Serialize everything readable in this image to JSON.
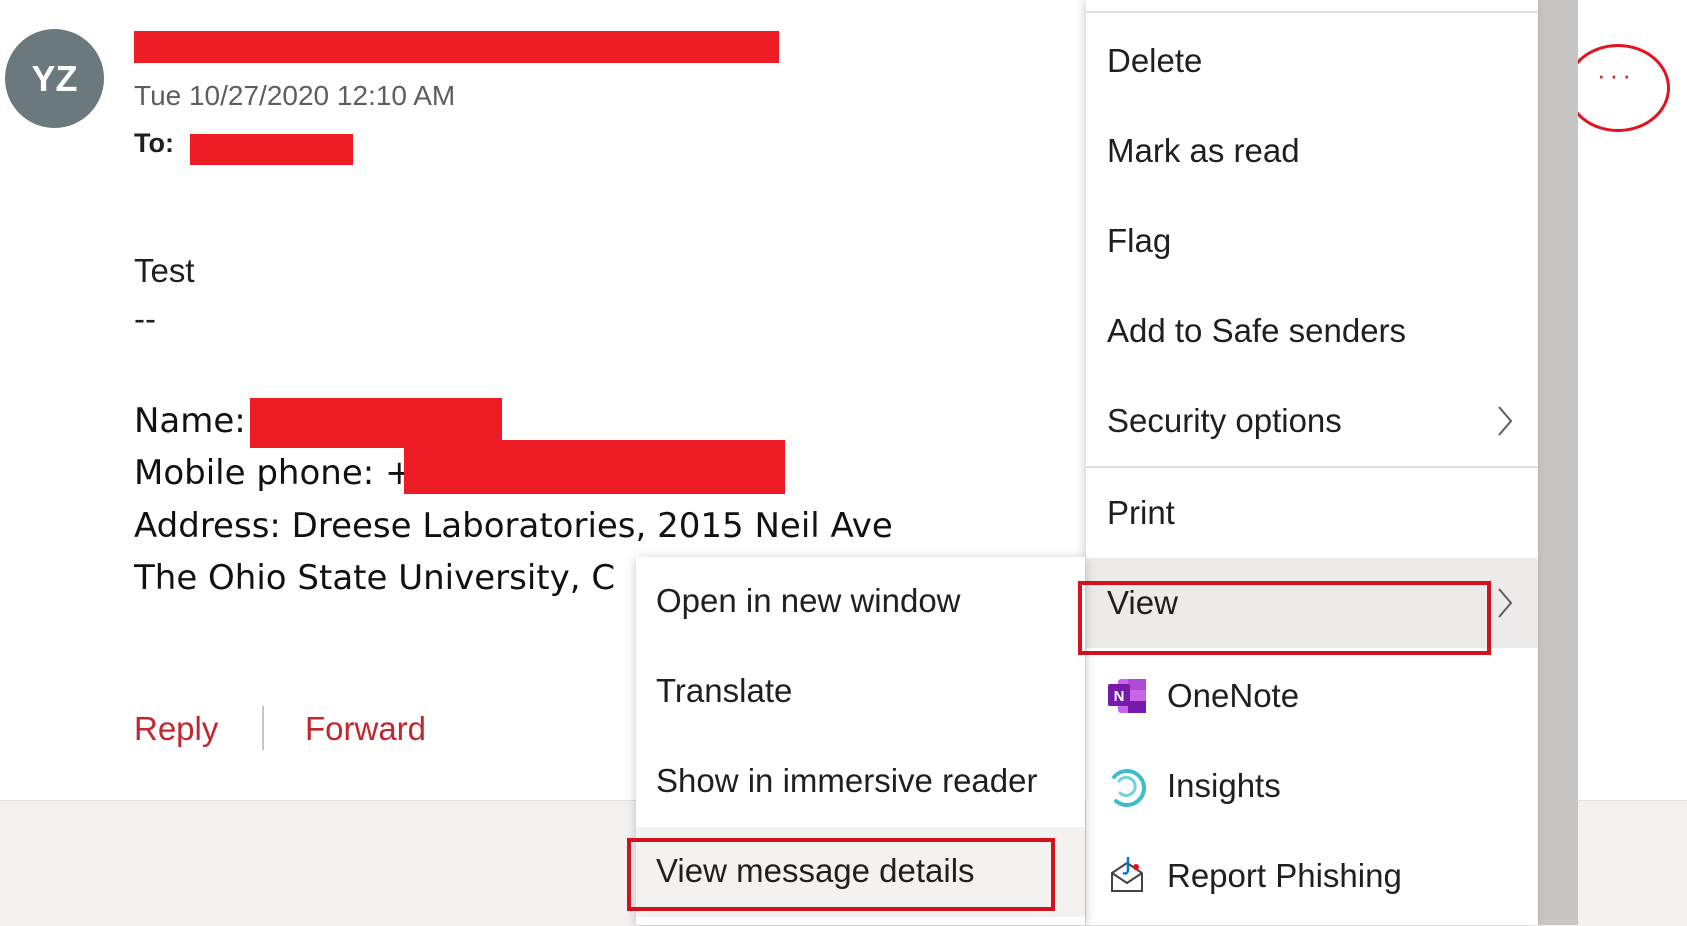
{
  "message": {
    "avatar_initials": "YZ",
    "date": "Tue 10/27/2020 12:10 AM",
    "to_label": "To:",
    "body": [
      "Test",
      "--"
    ],
    "signature": {
      "name_label": "Name:",
      "phone_label": "Mobile phone: +",
      "address": "Address: Dreese Laboratories, 2015 Neil Ave",
      "university": "The Ohio State University, C"
    },
    "actions": {
      "reply": "Reply",
      "forward": "Forward"
    }
  },
  "more_actions": {
    "label": "···"
  },
  "context_menu": {
    "items": [
      {
        "label": "Delete"
      },
      {
        "label": "Mark as read"
      },
      {
        "label": "Flag"
      },
      {
        "label": "Add to Safe senders"
      },
      {
        "label": "Security options",
        "submenu": true
      },
      {
        "label": "Print"
      },
      {
        "label": "View",
        "submenu": true,
        "active": true
      },
      {
        "label": "OneNote",
        "icon": "onenote-icon"
      },
      {
        "label": "Insights",
        "icon": "insights-icon"
      },
      {
        "label": "Report Phishing",
        "icon": "report-phishing-icon"
      }
    ]
  },
  "view_submenu": {
    "items": [
      {
        "label": "Open in new window"
      },
      {
        "label": "Translate"
      },
      {
        "label": "Show in immersive reader"
      },
      {
        "label": "View message details",
        "highlighted": true
      }
    ]
  },
  "colors": {
    "accent_red": "#c4262e",
    "redaction": "#ee1c25",
    "annotation_red": "#d3121d",
    "avatar_bg": "#69797e",
    "onenote": "#7719aa",
    "insights": "#3fbcc9"
  }
}
